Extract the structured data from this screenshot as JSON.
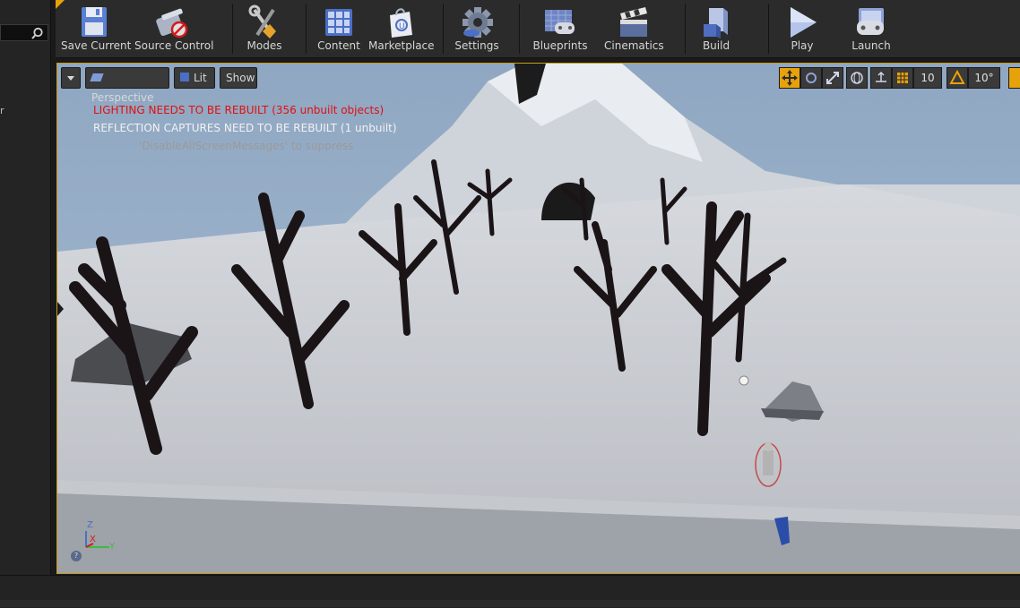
{
  "toolbar": {
    "save_current": "Save Current",
    "source_control": "Source Control",
    "modes": "Modes",
    "content": "Content",
    "marketplace": "Marketplace",
    "settings": "Settings",
    "blueprints": "Blueprints",
    "cinematics": "Cinematics",
    "build": "Build",
    "play": "Play",
    "launch": "Launch"
  },
  "left_panel": {
    "truncated_text": "r"
  },
  "viewport": {
    "perspective_label": "Perspective",
    "lit_label": "Lit",
    "show_label": "Show",
    "grid_snap_value": "10",
    "rotation_snap_value": "10°",
    "messages": {
      "lighting": "LIGHTING NEEDS TO BE REBUILT (356 unbuilt objects)",
      "reflection": "REFLECTION CAPTURES NEED TO BE REBUILT (1 unbuilt)",
      "suppress": "'DisableAllScreenMessages' to suppress"
    },
    "axis": {
      "z": "Z",
      "x": "X",
      "y": "Y"
    }
  },
  "colors": {
    "accent": "#e7a10b",
    "warning_red": "#e01010",
    "panel_bg": "#2b2b2b"
  }
}
